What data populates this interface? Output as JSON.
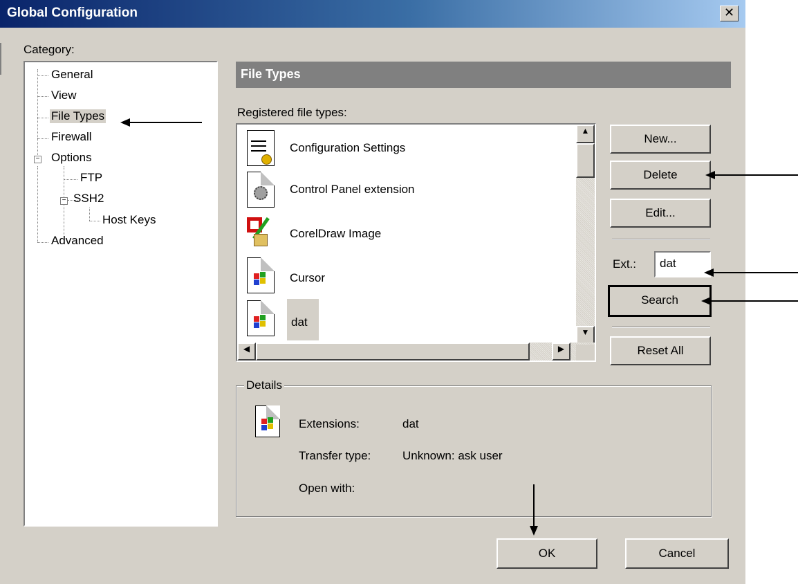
{
  "window": {
    "title": "Global Configuration",
    "close_glyph": "✕"
  },
  "category": {
    "label": "Category:",
    "items": [
      {
        "label": "General"
      },
      {
        "label": "View"
      },
      {
        "label": "File Types"
      },
      {
        "label": "Firewall"
      },
      {
        "label": "Options"
      },
      {
        "label": "FTP"
      },
      {
        "label": "SSH2"
      },
      {
        "label": "Host Keys"
      },
      {
        "label": "Advanced"
      }
    ]
  },
  "panel": {
    "header": "File Types",
    "registered_label": "Registered file types:",
    "file_types": [
      {
        "label": "Configuration Settings",
        "icon": "config-settings-icon"
      },
      {
        "label": "Control Panel extension",
        "icon": "control-panel-icon"
      },
      {
        "label": "CorelDraw Image",
        "icon": "coreldraw-icon"
      },
      {
        "label": "Cursor",
        "icon": "windows-logo-icon"
      },
      {
        "label": "dat",
        "icon": "windows-logo-icon",
        "selected": true
      }
    ]
  },
  "buttons": {
    "new": "New...",
    "delete": "Delete",
    "edit": "Edit...",
    "search": "Search",
    "reset_all": "Reset All",
    "ok": "OK",
    "cancel": "Cancel"
  },
  "ext": {
    "label": "Ext.:",
    "value": "dat"
  },
  "details": {
    "legend": "Details",
    "extensions_label": "Extensions:",
    "extensions_value": "dat",
    "transfer_label": "Transfer type:",
    "transfer_value": "Unknown: ask user",
    "open_label": "Open with:",
    "open_value": ""
  },
  "colors": {
    "title_start": "#0a246a",
    "title_end": "#a6caf0",
    "face": "#d4d0c8",
    "header": "#808080"
  }
}
